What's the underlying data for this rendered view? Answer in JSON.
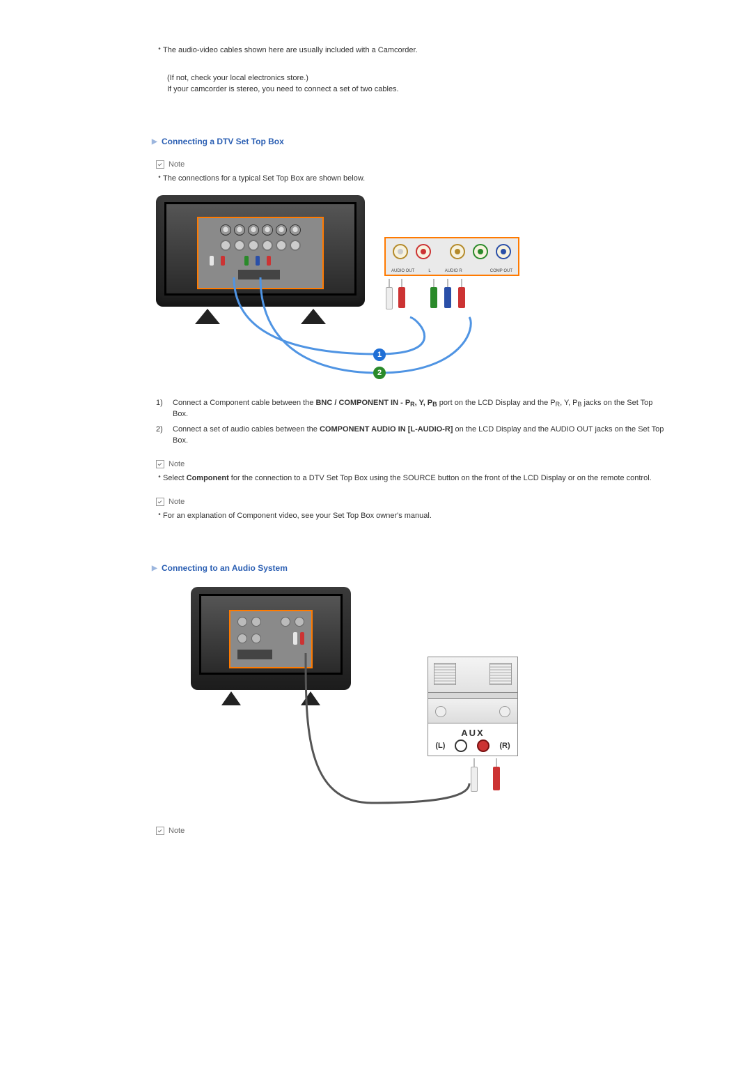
{
  "top": {
    "bullet": "The audio-video cables shown here are usually included with a Camcorder.",
    "line1": "(If not, check your local electronics store.)",
    "line2": "If your camcorder is stereo, you need to connect a set of two cables."
  },
  "dtv": {
    "heading": "Connecting a DTV Set Top Box",
    "note1": "Note",
    "bullet1": "The connections for a typical Set Top Box are shown below.",
    "badge1": "1",
    "badge2": "2",
    "steps": [
      {
        "num": "1)",
        "pre": "Connect a Component cable between the ",
        "bold": "BNC / COMPONENT IN - P",
        "sub1": "R",
        "mid1": ", Y, P",
        "sub2": "B",
        "post_a": " port on the LCD Display and the P",
        "sub3": "R",
        "post_b": ", Y, P",
        "sub4": "B",
        "post_c": " jacks on the Set Top Box."
      },
      {
        "num": "2)",
        "pre": "Connect a set of audio cables between the ",
        "bold": "COMPONENT AUDIO IN [L-AUDIO-R]",
        "post": " on the LCD Display and the AUDIO OUT jacks on the Set Top Box."
      }
    ],
    "note2": "Note",
    "bullet2_pre": "Select ",
    "bullet2_bold": "Component",
    "bullet2_post": " for the connection to a DTV Set Top Box using the SOURCE button on the front of the LCD Display or on the remote control.",
    "note3": "Note",
    "bullet3": "For an explanation of Component video, see your Set Top Box owner's manual."
  },
  "audio": {
    "heading": "Connecting to an Audio System",
    "aux": "AUX",
    "L": "(L)",
    "R": "(R)",
    "noteEnd": "Note"
  }
}
